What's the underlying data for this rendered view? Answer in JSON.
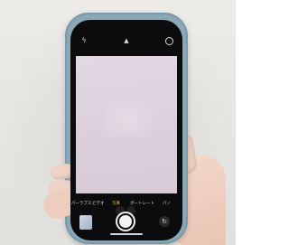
{
  "camera": {
    "top_icons": {
      "flash": "flash-icon",
      "chevron": "chevron-up-icon",
      "live": "live-photo-icon"
    },
    "zoom": {
      "options": [
        "",
        ""
      ],
      "selected_index": 1
    },
    "modes": {
      "items": [
        "ハイパーラプス",
        "ビデオ",
        "写真",
        "ポートレート",
        "パノ"
      ],
      "selected_index": 2
    },
    "controls": {
      "thumbnail": "photo-thumbnail",
      "shutter": "shutter-button",
      "switch": "camera-switch-icon"
    }
  },
  "colors": {
    "case": "#8aa7b6",
    "viewfinder": "#ddd3de",
    "mode_highlight": "#f0c33a"
  }
}
